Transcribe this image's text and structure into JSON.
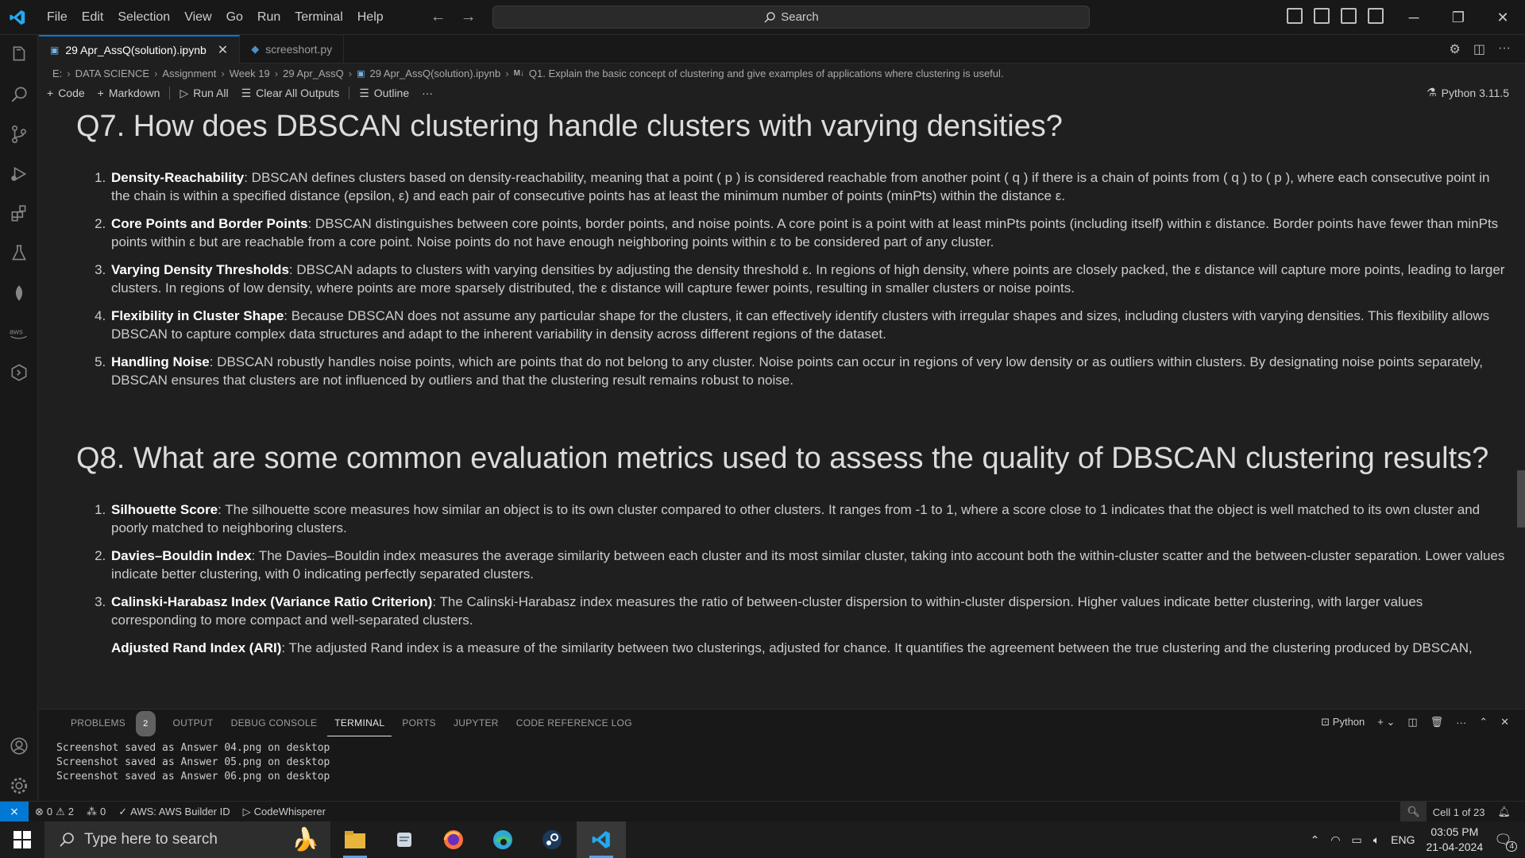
{
  "titlebar": {
    "menu": [
      "File",
      "Edit",
      "Selection",
      "View",
      "Go",
      "Run",
      "Terminal",
      "Help"
    ],
    "search_label": "Search"
  },
  "tabs": [
    {
      "label": "29 Apr_AssQ(solution).ipynb",
      "active": true
    },
    {
      "label": "screeshort.py",
      "active": false
    }
  ],
  "breadcrumb": [
    "E:",
    "DATA SCIENCE",
    "Assignment",
    "Week 19",
    "29 Apr_AssQ",
    "29 Apr_AssQ(solution).ipynb",
    "Q1. Explain the basic concept of clustering and give examples of applications where clustering is useful."
  ],
  "notebook_toolbar": {
    "code": "Code",
    "markdown": "Markdown",
    "run_all": "Run All",
    "clear_all": "Clear All Outputs",
    "outline": "Outline",
    "more": "···",
    "kernel": "Python 3.11.5"
  },
  "content": {
    "q7_title": "Q7. How does DBSCAN clustering handle clusters with varying densities?",
    "q7_items": [
      {
        "term": "Density-Reachability",
        "text": ": DBSCAN defines clusters based on density-reachability, meaning that a point ( p ) is considered reachable from another point ( q ) if there is a chain of points from ( q ) to ( p ), where each consecutive point in the chain is within a specified distance (epsilon, ε) and each pair of consecutive points has at least the minimum number of points (minPts) within the distance ε."
      },
      {
        "term": "Core Points and Border Points",
        "text": ": DBSCAN distinguishes between core points, border points, and noise points. A core point is a point with at least minPts points (including itself) within ε distance. Border points have fewer than minPts points within ε but are reachable from a core point. Noise points do not have enough neighboring points within ε to be considered part of any cluster."
      },
      {
        "term": "Varying Density Thresholds",
        "text": ": DBSCAN adapts to clusters with varying densities by adjusting the density threshold ε. In regions of high density, where points are closely packed, the ε distance will capture more points, leading to larger clusters. In regions of low density, where points are more sparsely distributed, the ε distance will capture fewer points, resulting in smaller clusters or noise points."
      },
      {
        "term": "Flexibility in Cluster Shape",
        "text": ": Because DBSCAN does not assume any particular shape for the clusters, it can effectively identify clusters with irregular shapes and sizes, including clusters with varying densities. This flexibility allows DBSCAN to capture complex data structures and adapt to the inherent variability in density across different regions of the dataset."
      },
      {
        "term": "Handling Noise",
        "text": ": DBSCAN robustly handles noise points, which are points that do not belong to any cluster. Noise points can occur in regions of very low density or as outliers within clusters. By designating noise points separately, DBSCAN ensures that clusters are not influenced by outliers and that the clustering result remains robust to noise."
      }
    ],
    "q8_title": "Q8. What are some common evaluation metrics used to assess the quality of DBSCAN clustering results?",
    "q8_items": [
      {
        "term": "Silhouette Score",
        "text": ": The silhouette score measures how similar an object is to its own cluster compared to other clusters. It ranges from -1 to 1, where a score close to 1 indicates that the object is well matched to its own cluster and poorly matched to neighboring clusters."
      },
      {
        "term": "Davies–Bouldin Index",
        "text": ": The Davies–Bouldin index measures the average similarity between each cluster and its most similar cluster, taking into account both the within-cluster scatter and the between-cluster separation. Lower values indicate better clustering, with 0 indicating perfectly separated clusters."
      },
      {
        "term": "Calinski-Harabasz Index (Variance Ratio Criterion)",
        "text": ": The Calinski-Harabasz index measures the ratio of between-cluster dispersion to within-cluster dispersion. Higher values indicate better clustering, with larger values corresponding to more compact and well-separated clusters."
      },
      {
        "term": "Adjusted Rand Index (ARI)",
        "text": ": The adjusted Rand index is a measure of the similarity between two clusterings, adjusted for chance. It quantifies the agreement between the true clustering and the clustering produced by DBSCAN,"
      }
    ]
  },
  "panel": {
    "tabs": [
      "PROBLEMS",
      "OUTPUT",
      "DEBUG CONSOLE",
      "TERMINAL",
      "PORTS",
      "JUPYTER",
      "CODE REFERENCE LOG"
    ],
    "problems_count": "2",
    "active_tab": "TERMINAL",
    "shell": "Python",
    "terminal_lines": [
      "Screenshot saved as Answer 04.png on desktop",
      "Screenshot saved as Answer 05.png on desktop",
      "Screenshot saved as Answer 06.png on desktop"
    ]
  },
  "statusbar": {
    "errors": "0",
    "warnings": "2",
    "ports": "0",
    "aws": "AWS: AWS Builder ID",
    "codewhisperer": "CodeWhisperer",
    "cell": "Cell 1 of 23"
  },
  "taskbar": {
    "search_placeholder": "Type here to search",
    "lang": "ENG",
    "time": "03:05 PM",
    "date": "21-04-2024",
    "notifications": "4"
  },
  "colors": {
    "accent": "#0078d4",
    "editor_bg": "#1f1f1f",
    "chrome_bg": "#181818"
  }
}
